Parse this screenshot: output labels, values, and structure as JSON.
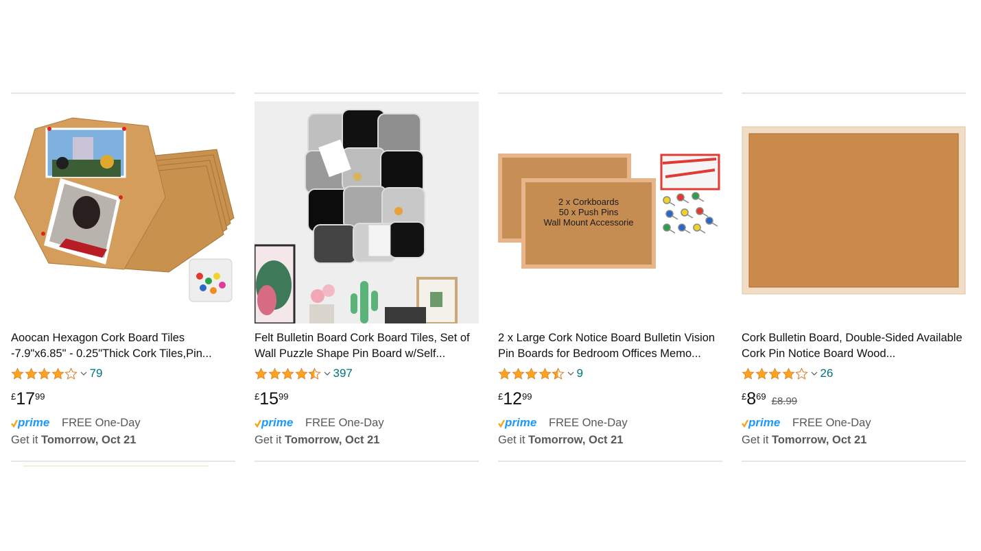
{
  "products": [
    {
      "title": "Aoocan Hexagon Cork Board Tiles -7.9\"x6.85\" - 0.25\"Thick Cork Tiles,Pin...",
      "rating": 4.0,
      "stars_icons": [
        "star-full-icon",
        "star-full-icon",
        "star-full-icon",
        "star-full-icon",
        "star-empty-icon"
      ],
      "review_count": "79",
      "price_currency": "£",
      "price_whole": "17",
      "price_fraction": "99",
      "list_price": "",
      "prime_label": "prime",
      "delivery_label": "FREE One-Day",
      "get_it_prefix": "Get it",
      "delivery_date": "Tomorrow, Oct 21"
    },
    {
      "title": "Felt Bulletin Board Cork Board Tiles, Set of Wall Puzzle Shape Pin Board w/Self...",
      "rating": 4.5,
      "stars_icons": [
        "star-full-icon",
        "star-full-icon",
        "star-full-icon",
        "star-full-icon",
        "star-half-icon"
      ],
      "review_count": "397",
      "price_currency": "£",
      "price_whole": "15",
      "price_fraction": "99",
      "list_price": "",
      "prime_label": "prime",
      "delivery_label": "FREE One-Day",
      "get_it_prefix": "Get it",
      "delivery_date": "Tomorrow, Oct 21"
    },
    {
      "title": "2 x Large Cork Notice Board Bulletin Vision Pin Boards for Bedroom Offices Memo...",
      "rating": 4.5,
      "stars_icons": [
        "star-full-icon",
        "star-full-icon",
        "star-full-icon",
        "star-full-icon",
        "star-half-icon"
      ],
      "review_count": "9",
      "price_currency": "£",
      "price_whole": "12",
      "price_fraction": "99",
      "list_price": "",
      "prime_label": "prime",
      "delivery_label": "FREE One-Day",
      "get_it_prefix": "Get it",
      "delivery_date": "Tomorrow, Oct 21",
      "image_text": [
        "2 x Corkboards",
        "50 x Push Pins",
        "Wall Mount Accessorie"
      ]
    },
    {
      "title": "Cork Bulletin Board, Double-Sided Available Cork Pin Notice Board Wood...",
      "rating": 4.0,
      "stars_icons": [
        "star-full-icon",
        "star-full-icon",
        "star-full-icon",
        "star-full-icon",
        "star-empty-icon"
      ],
      "review_count": "26",
      "price_currency": "£",
      "price_whole": "8",
      "price_fraction": "69",
      "list_price": "£8.99",
      "prime_label": "prime",
      "delivery_label": "FREE One-Day",
      "get_it_prefix": "Get it",
      "delivery_date": "Tomorrow, Oct 21"
    }
  ],
  "colors": {
    "star": "#ffa41c",
    "link": "#007185",
    "prime_blue": "#1a98ff",
    "prime_check": "#f7a51b",
    "text": "#0f1111",
    "muted": "#565959",
    "divider": "#e3e6e6"
  }
}
